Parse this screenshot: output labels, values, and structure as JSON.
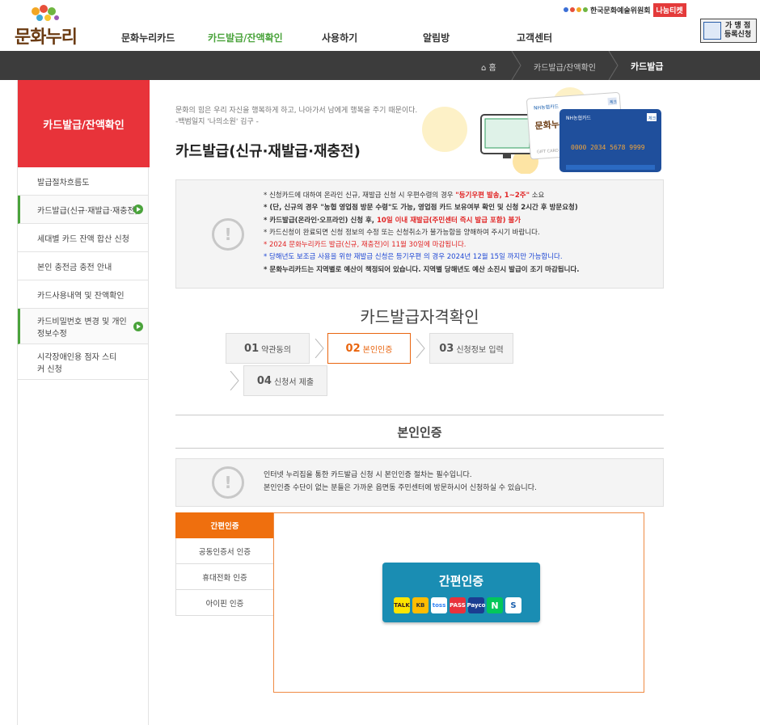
{
  "header": {
    "logo_text": "문화누리",
    "nav": [
      "문화누리카드",
      "카드발급/잔액확인",
      "사용하기",
      "알림방",
      "고객센터"
    ],
    "arts_council": "한국문화예술위원회",
    "nanum_ticket": "나눔티켓",
    "store_btn_line1": "가 맹 점",
    "store_btn_line2": "등록신청"
  },
  "breadcrumb": {
    "home": "홈",
    "level1": "카드발급/잔액확인",
    "current": "카드발급"
  },
  "sidebar": {
    "title": "카드발급/잔액확인",
    "items": [
      {
        "label": "발급절차흐름도"
      },
      {
        "label": "카드발급(신규·재발급·재충전)"
      },
      {
        "label": "세대별 카드 잔액 합산 신청"
      },
      {
        "label": "본인 충전금 충전 안내"
      },
      {
        "label": "카드사용내역 및 잔액확인"
      },
      {
        "label": "카드비밀번호 변경 및 개인 정보수정"
      },
      {
        "label": "시각장애인용 점자 스티커 신청"
      }
    ]
  },
  "quote": {
    "line1": "문화의 힘은 우리 자신을 행복하게 하고, 나아가서 남에게 행복을 주기 때문이다.",
    "line2": "-백범일지 '나의소원' 김구 -"
  },
  "page_title": "카드발급(신규·재발급·재충전)",
  "hero_card": {
    "nh_label": "NH농협카드",
    "brand": "문화누리",
    "number": "0000 2034 5678 9999",
    "gift_card": "GIFT CARD",
    "badge": "체크"
  },
  "notice": {
    "lines": [
      {
        "a": "* 신청카드에 대하여 온라인 신규, 재발급 신청 시 우편수령의 경우 ",
        "b": "\"등기우편 발송, 1~2주\"",
        "c": " 소요"
      },
      {
        "a": "* (단, 신규의 경우 \"농협 영업점 방문 수령\"도 가능, 영업점 카드 보유여부 확인 및 신청 2시간 후 방문요청)",
        "b": "",
        "c": ""
      },
      {
        "a": "* 카드발급(온라인·오프라인) 신청 후, ",
        "b": "10일 이내 재발급(주민센터 즉시 발급 포함) 불가",
        "c": ""
      },
      {
        "a": "* 카드신청이 완료되면 신청 정보의 수정 또는 신청취소가 불가능함을 양해하여 주시기 바랍니다.",
        "b": "",
        "c": ""
      },
      {
        "a": "* 2024 문화누리카드 발급(신규, 재충전)이 11월 30일에 마감됩니다.",
        "b": "",
        "c": ""
      },
      {
        "a": "* 당해년도 보조금 사용을 위한 재발급 신청은 등기우편 의 경우 2024년 12월 15일 까지만 가능합니다.",
        "b": "",
        "c": ""
      },
      {
        "a": "* 문화누리카드는 지역별로 예산이 책정되어 있습니다. 지역별 당해년도 예산 소진시 발급이 조기 마감됩니다.",
        "b": "",
        "c": ""
      }
    ]
  },
  "qualify_title": "카드발급자격확인",
  "steps": [
    {
      "num": "01",
      "label": "약관동의"
    },
    {
      "num": "02",
      "label": "본인인증"
    },
    {
      "num": "03",
      "label": "신청정보 입력"
    },
    {
      "num": "04",
      "label": "신청서 제출"
    }
  ],
  "auth_section_title": "본인인증",
  "info": {
    "line1": "인터넷 누리집을 통한 카드발급 신청 시 본인인증 절차는 필수입니다.",
    "line2": "본인인증 수단이 없는 분들은 가까운 읍면동 주민센터에 방문하시어 신청하실 수 있습니다."
  },
  "auth_tabs": [
    "간편인증",
    "공동인증서 인증",
    "휴대전화 인증",
    "아이핀 인증"
  ],
  "simple_auth": {
    "label": "간편인증",
    "providers": [
      "TALK",
      "KB",
      "toss",
      "PASS",
      "Payco",
      "N",
      "S"
    ]
  }
}
